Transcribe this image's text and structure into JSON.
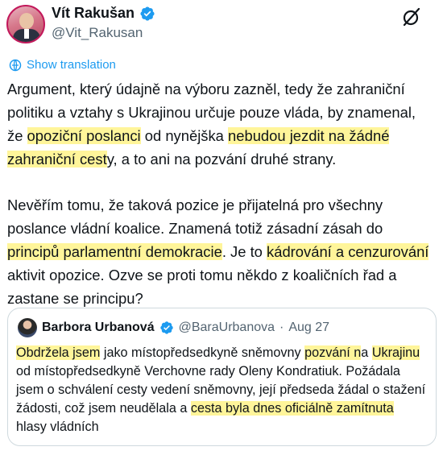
{
  "author": {
    "name": "Vít Rakušan",
    "handle": "@Vit_Rakusan"
  },
  "translate_label": "Show translation",
  "tweet": {
    "p1": [
      {
        "t": "Argument, který údajně na výboru zazněl, tedy že zahraniční politiku a vztahy s Ukrajinou určuje pouze vláda, by znamenal, že ",
        "h": false
      },
      {
        "t": "opoziční poslanci",
        "h": true
      },
      {
        "t": " od nynějška ",
        "h": false
      },
      {
        "t": "nebudou jezdit na žádné zahraniční cest",
        "h": true
      },
      {
        "t": "y, a to ani na pozvání druhé strany.",
        "h": false
      }
    ],
    "p2": [
      {
        "t": "Nevěřím tomu, že taková pozice je přijatelná pro všechny poslance vládní koalice. Znamená totiž zásadní zásah do ",
        "h": false
      },
      {
        "t": "principů pa",
        "h": true
      },
      {
        "t": "rlamentní demokracie",
        "h": true
      },
      {
        "t": ". Je to ",
        "h": false
      },
      {
        "t": "kádrování a cenzurování",
        "h": true
      },
      {
        "t": " aktivit opozice.  Ozve se proti tomu někdo z koaličních řad a zastane se principu?",
        "h": false
      }
    ]
  },
  "quote": {
    "name": "Barbora Urbanová",
    "handle": "@BaraUrbanova",
    "separator": "·",
    "date": "Aug 27",
    "text": [
      {
        "t": "Obdržela jsem",
        "h": true
      },
      {
        "t": " jako místopředsedkyně sněmovny ",
        "h": false
      },
      {
        "t": "pozvání n",
        "h": true
      },
      {
        "t": "a ",
        "h": false
      },
      {
        "t": "Ukrajinu",
        "h": true
      },
      {
        "t": " od místopředsedkyně Verchovne rady Oleny Kondratiuk. Požádala jsem o schválení cesty vedení sněmovny, její předseda žádal o stažení žádosti, což jsem neudělala a ",
        "h": false
      },
      {
        "t": "cesta byla dnes oficiálně zamítnuta",
        "h": true
      },
      {
        "t": " hlasy vládních",
        "h": false
      }
    ]
  },
  "colors": {
    "accent": "#1d9bf0",
    "highlight": "#fff59a",
    "verified": "#1d9bf0"
  }
}
